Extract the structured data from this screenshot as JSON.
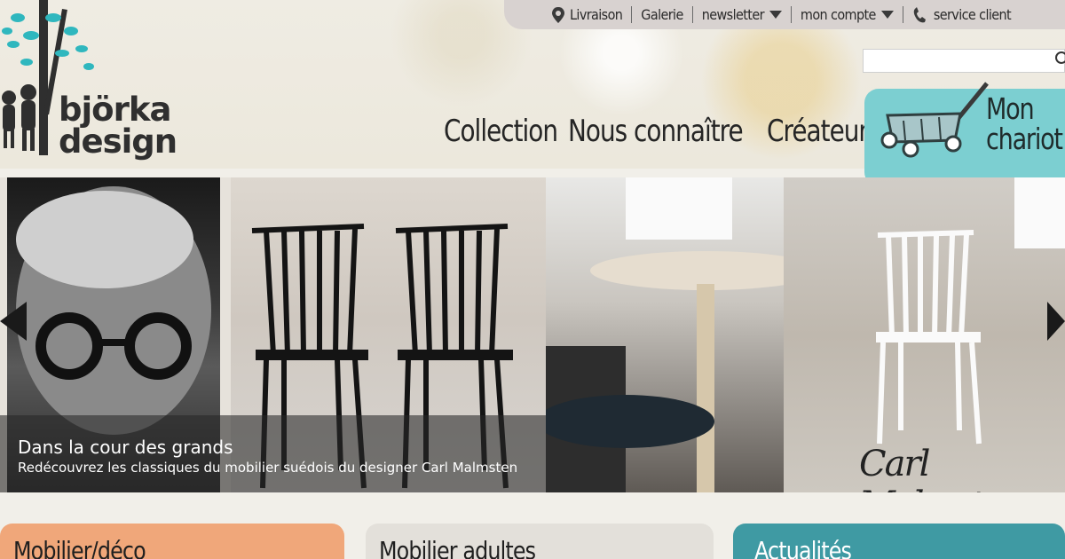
{
  "utility_bar": {
    "items": [
      {
        "label": "Livraison",
        "icon": "map-pin-icon"
      },
      {
        "label": "Galerie"
      },
      {
        "label": "newsletter",
        "icon": "caret-down-icon"
      },
      {
        "label": "mon compte",
        "icon": "caret-down-icon"
      },
      {
        "label": "service client",
        "icon": "phone-icon"
      }
    ]
  },
  "logo": {
    "line1": "björka",
    "line2": "design"
  },
  "nav": {
    "items": [
      "Collection",
      "Nous connaître",
      "Créateurs"
    ]
  },
  "search": {
    "placeholder": ""
  },
  "cart": {
    "line1": "Mon",
    "line2": "chariot",
    "icon": "wagon-icon"
  },
  "slider": {
    "title": "Dans la cour des grands",
    "subtitle": "Redécouvrez les classiques du mobilier suédois du designer Carl Malmsten",
    "signature": "Carl Malmsten"
  },
  "boxes": [
    {
      "label": "Mobilier/déco",
      "color": "#f0a77a"
    },
    {
      "label": "Mobilier adultes",
      "color": "#e3e0da"
    },
    {
      "label": "Actualités",
      "color": "#3f9aa3"
    }
  ]
}
